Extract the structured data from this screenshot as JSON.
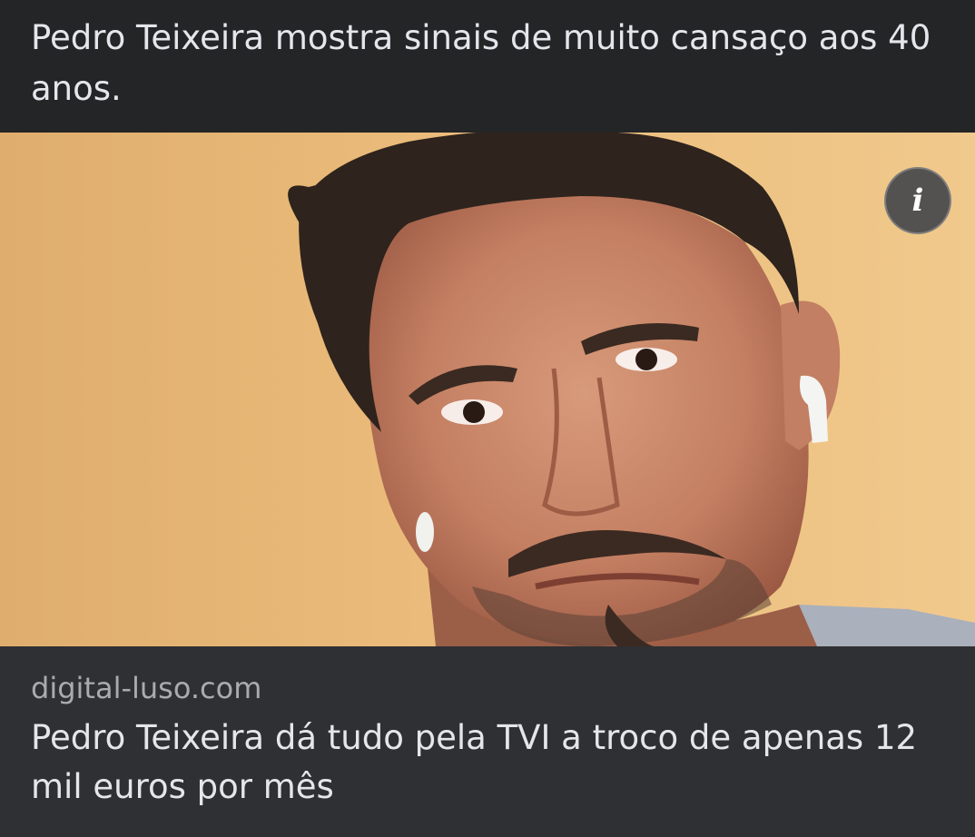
{
  "post": {
    "caption": "Pedro Teixeira mostra sinais de muito cansaço aos 40 anos."
  },
  "link_preview": {
    "info_icon": "info-icon",
    "info_glyph": "i",
    "domain": "digital-luso.com",
    "title": "Pedro Teixeira dá tudo pela TVI a troco de apenas 12 mil euros por mês"
  },
  "colors": {
    "background": "#242526",
    "card_footer": "#2f3033",
    "text_primary": "#e4e6eb",
    "text_secondary": "#a8abb0",
    "wall": "#eab977"
  }
}
